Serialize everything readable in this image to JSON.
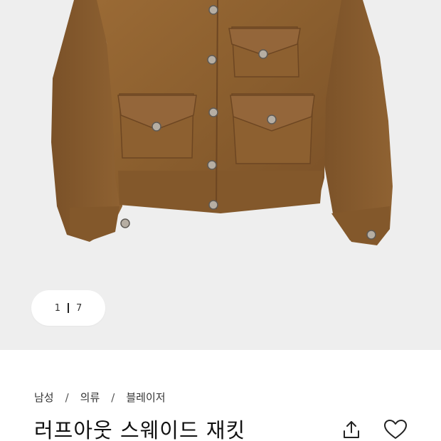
{
  "gallery": {
    "current": "1",
    "total": "7"
  },
  "breadcrumb": [
    "남성",
    "의류",
    "블레이저"
  ],
  "product": {
    "title": "러프아웃 스웨이드 재킷"
  },
  "icons": {
    "share": "share-icon",
    "like": "heart-icon"
  },
  "colors": {
    "suede": "#8a5e2e",
    "background": "#eeeeee"
  }
}
